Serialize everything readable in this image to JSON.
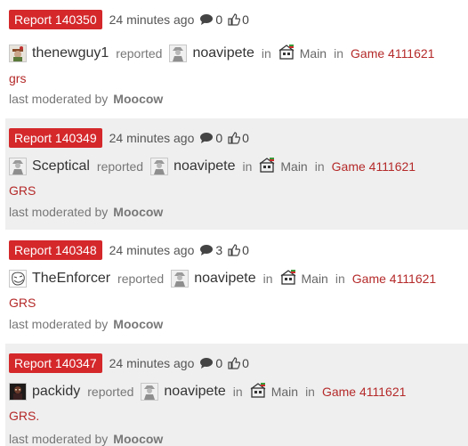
{
  "reports": [
    {
      "id_label": "Report 140350",
      "time": "24 minutes ago",
      "comments": "0",
      "likes": "0",
      "reporter": "thenewguy1",
      "reporter_avatar": "cowboy-avatar-icon",
      "verb": "reported",
      "target": "noavipete",
      "in1": "in",
      "faction": "Main",
      "in2": "in",
      "game": "Game 4111621",
      "reason": "grs",
      "moderated_label": "last moderated by",
      "moderator": "Moocow"
    },
    {
      "id_label": "Report 140349",
      "time": "24 minutes ago",
      "comments": "0",
      "likes": "0",
      "reporter": "Sceptical",
      "reporter_avatar": "default-avatar-icon",
      "verb": "reported",
      "target": "noavipete",
      "in1": "in",
      "faction": "Main",
      "in2": "in",
      "game": "Game 4111621",
      "reason": "GRS",
      "moderated_label": "last moderated by",
      "moderator": "Moocow"
    },
    {
      "id_label": "Report 140348",
      "time": "24 minutes ago",
      "comments": "3",
      "likes": "0",
      "reporter": "TheEnforcer",
      "reporter_avatar": "troll-face-avatar-icon",
      "verb": "reported",
      "target": "noavipete",
      "in1": "in",
      "faction": "Main",
      "in2": "in",
      "game": "Game 4111621",
      "reason": "GRS",
      "moderated_label": "last moderated by",
      "moderator": "Moocow"
    },
    {
      "id_label": "Report 140347",
      "time": "24 minutes ago",
      "comments": "0",
      "likes": "0",
      "reporter": "packidy",
      "reporter_avatar": "dark-character-avatar-icon",
      "verb": "reported",
      "target": "noavipete",
      "in1": "in",
      "faction": "Main",
      "in2": "in",
      "game": "Game 4111621",
      "reason": "GRS.",
      "moderated_label": "last moderated by",
      "moderator": "Moocow"
    }
  ],
  "colors": {
    "report_button": "#d4282b",
    "link": "#b52a2a",
    "alt_row_bg": "#efefef"
  }
}
